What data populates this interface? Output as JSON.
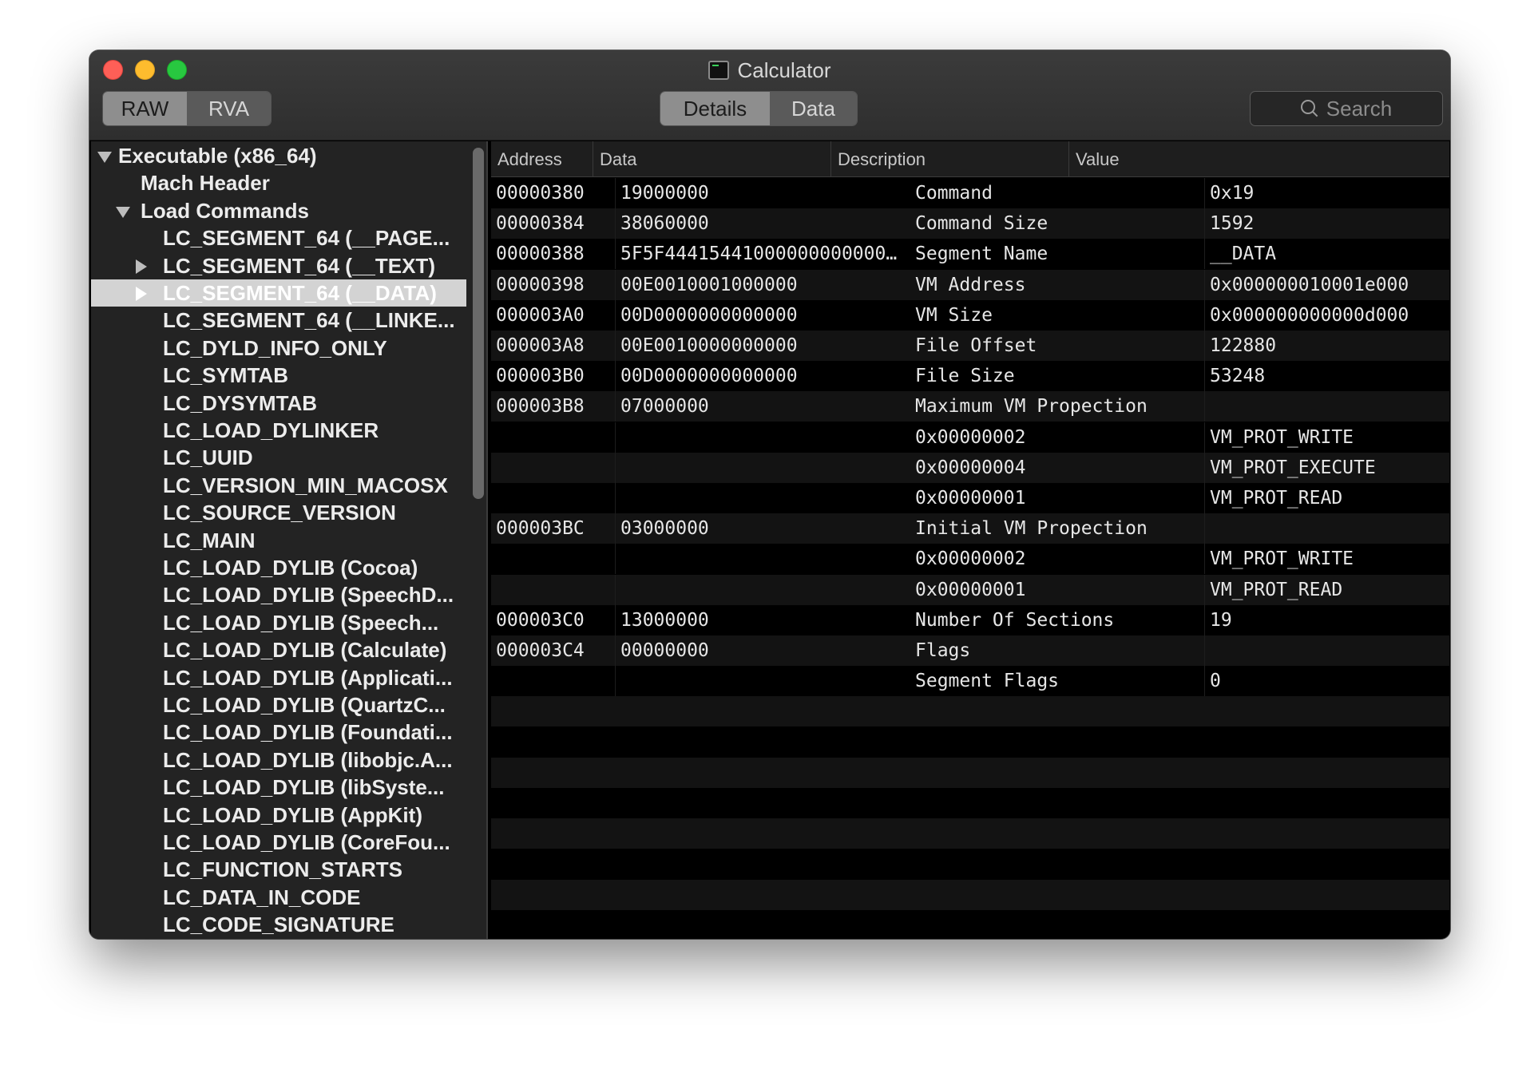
{
  "window": {
    "title": "Calculator",
    "title_icon": "terminal-document-icon"
  },
  "toolbar": {
    "raw_label": "RAW",
    "rva_label": "RVA",
    "details_label": "Details",
    "data_label": "Data",
    "search_placeholder": "Search"
  },
  "sidebar": {
    "items": [
      {
        "label": "Executable (x86_64)",
        "disclosure": "expanded"
      },
      {
        "label": "Mach Header",
        "disclosure": "none"
      },
      {
        "label": "Load Commands",
        "disclosure": "expanded"
      },
      {
        "label": "LC_SEGMENT_64 (__PAGE...",
        "disclosure": "none"
      },
      {
        "label": "LC_SEGMENT_64 (__TEXT)",
        "disclosure": "collapsed"
      },
      {
        "label": "LC_SEGMENT_64 (__DATA)",
        "disclosure": "collapsed",
        "selected": true
      },
      {
        "label": "LC_SEGMENT_64 (__LINKE...",
        "disclosure": "none"
      },
      {
        "label": "LC_DYLD_INFO_ONLY",
        "disclosure": "none"
      },
      {
        "label": "LC_SYMTAB",
        "disclosure": "none"
      },
      {
        "label": "LC_DYSYMTAB",
        "disclosure": "none"
      },
      {
        "label": "LC_LOAD_DYLINKER",
        "disclosure": "none"
      },
      {
        "label": "LC_UUID",
        "disclosure": "none"
      },
      {
        "label": "LC_VERSION_MIN_MACOSX",
        "disclosure": "none"
      },
      {
        "label": "LC_SOURCE_VERSION",
        "disclosure": "none"
      },
      {
        "label": "LC_MAIN",
        "disclosure": "none"
      },
      {
        "label": "LC_LOAD_DYLIB (Cocoa)",
        "disclosure": "none"
      },
      {
        "label": "LC_LOAD_DYLIB (SpeechD...",
        "disclosure": "none"
      },
      {
        "label": "LC_LOAD_DYLIB (Speech...",
        "disclosure": "none"
      },
      {
        "label": "LC_LOAD_DYLIB (Calculate)",
        "disclosure": "none"
      },
      {
        "label": "LC_LOAD_DYLIB (Applicati...",
        "disclosure": "none"
      },
      {
        "label": "LC_LOAD_DYLIB (QuartzC...",
        "disclosure": "none"
      },
      {
        "label": "LC_LOAD_DYLIB (Foundati...",
        "disclosure": "none"
      },
      {
        "label": "LC_LOAD_DYLIB (libobjc.A...",
        "disclosure": "none"
      },
      {
        "label": "LC_LOAD_DYLIB (libSyste...",
        "disclosure": "none"
      },
      {
        "label": "LC_LOAD_DYLIB (AppKit)",
        "disclosure": "none"
      },
      {
        "label": "LC_LOAD_DYLIB (CoreFou...",
        "disclosure": "none"
      },
      {
        "label": "LC_FUNCTION_STARTS",
        "disclosure": "none"
      },
      {
        "label": "LC_DATA_IN_CODE",
        "disclosure": "none"
      },
      {
        "label": "LC_CODE_SIGNATURE",
        "disclosure": "none"
      }
    ]
  },
  "table": {
    "columns": [
      "Address",
      "Data",
      "Description",
      "Value"
    ],
    "rows": [
      {
        "address": "00000380",
        "data": "19000000",
        "description": "Command",
        "value": "0x19"
      },
      {
        "address": "00000384",
        "data": "38060000",
        "description": "Command Size",
        "value": "1592"
      },
      {
        "address": "00000388",
        "data": "5F5F44415441000000000000…",
        "description": "Segment Name",
        "value": "__DATA"
      },
      {
        "address": "00000398",
        "data": "00E0010001000000",
        "description": "VM Address",
        "value": "0x000000010001e000"
      },
      {
        "address": "000003A0",
        "data": "00D0000000000000",
        "description": "VM Size",
        "value": "0x000000000000d000"
      },
      {
        "address": "000003A8",
        "data": "00E0010000000000",
        "description": "File Offset",
        "value": "122880"
      },
      {
        "address": "000003B0",
        "data": "00D0000000000000",
        "description": "File Size",
        "value": "53248"
      },
      {
        "address": "000003B8",
        "data": "07000000",
        "description": "Maximum VM Propection",
        "value": ""
      },
      {
        "address": "",
        "data": "",
        "description": "0x00000002",
        "value": "VM_PROT_WRITE"
      },
      {
        "address": "",
        "data": "",
        "description": "0x00000004",
        "value": "VM_PROT_EXECUTE"
      },
      {
        "address": "",
        "data": "",
        "description": "0x00000001",
        "value": "VM_PROT_READ"
      },
      {
        "address": "000003BC",
        "data": "03000000",
        "description": "Initial VM Propection",
        "value": ""
      },
      {
        "address": "",
        "data": "",
        "description": "0x00000002",
        "value": "VM_PROT_WRITE"
      },
      {
        "address": "",
        "data": "",
        "description": "0x00000001",
        "value": "VM_PROT_READ"
      },
      {
        "address": "000003C0",
        "data": "13000000",
        "description": "Number Of Sections",
        "value": "19"
      },
      {
        "address": "000003C4",
        "data": "00000000",
        "description": "Flags",
        "value": ""
      },
      {
        "address": "",
        "data": "",
        "description": "Segment Flags",
        "value": "0"
      }
    ]
  }
}
